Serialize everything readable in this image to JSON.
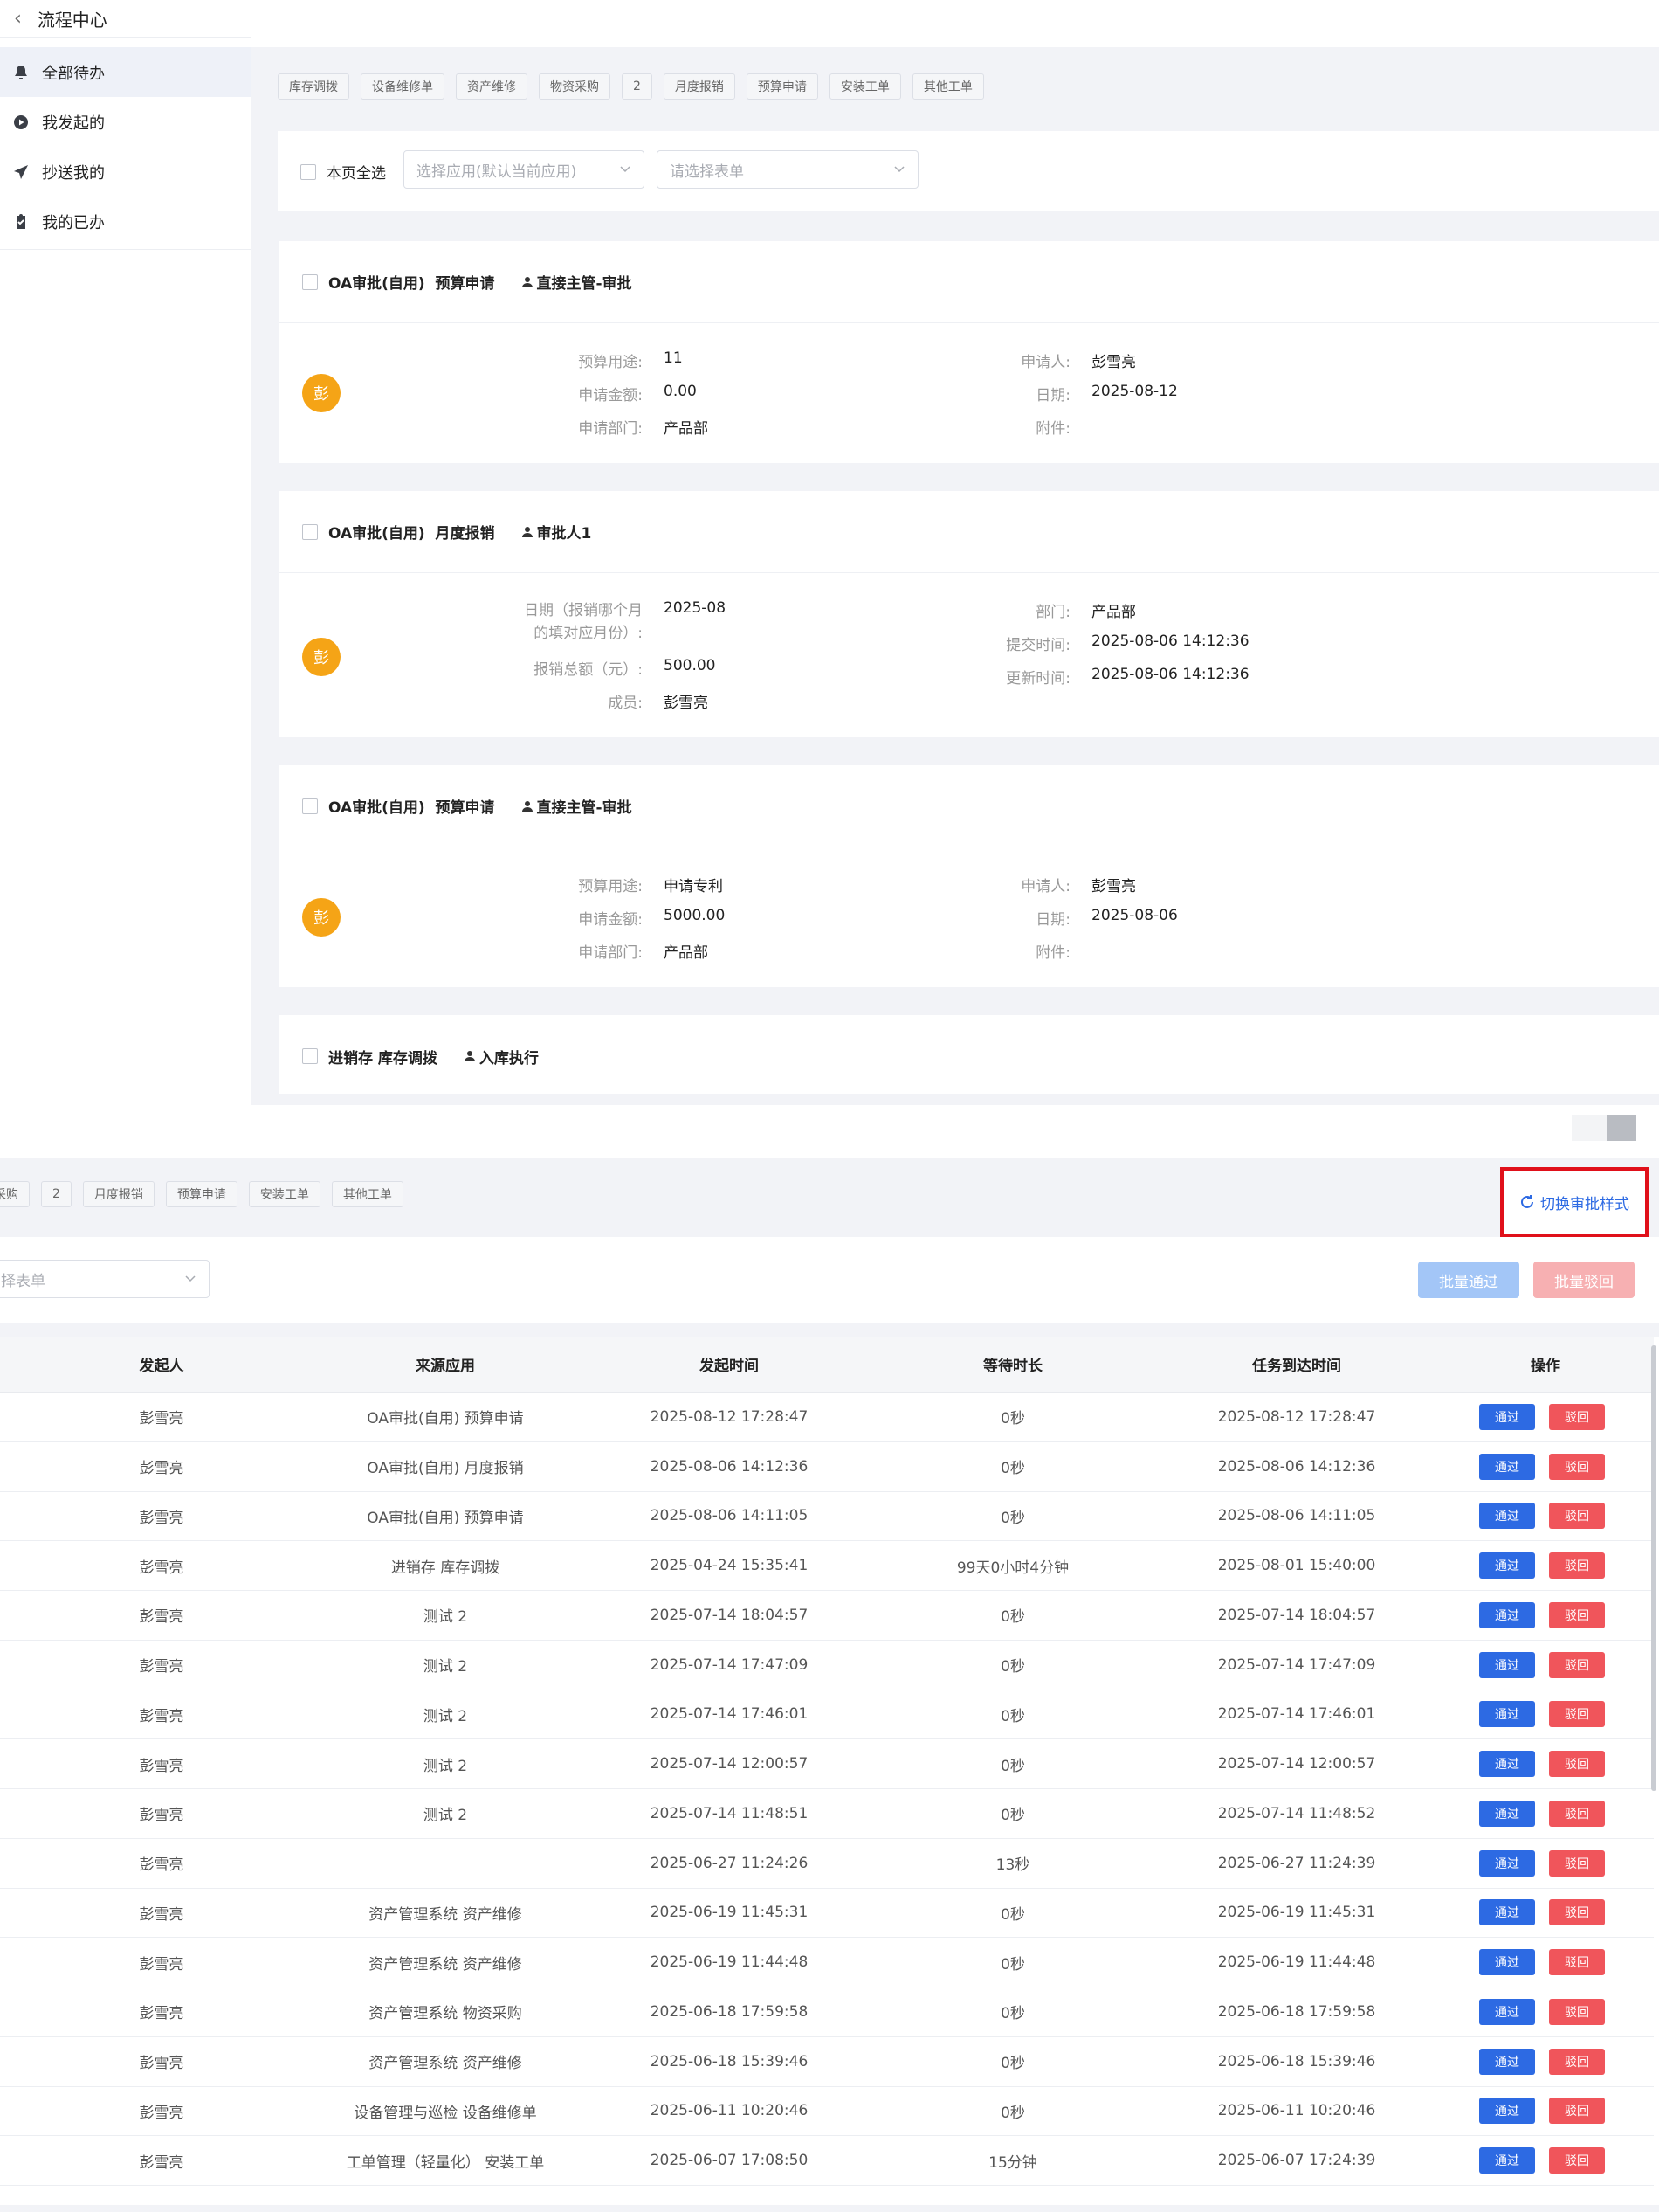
{
  "sidebar": {
    "title": "流程中心",
    "items": [
      {
        "label": "全部待办",
        "icon": "bell-icon",
        "active": true
      },
      {
        "label": "我发起的",
        "icon": "play-circle-icon",
        "active": false
      },
      {
        "label": "抄送我的",
        "icon": "send-icon",
        "active": false
      },
      {
        "label": "我的已办",
        "icon": "clipboard-check-icon",
        "active": false
      }
    ]
  },
  "top": {
    "chips": [
      "库存调拨",
      "设备维修单",
      "资产维修",
      "物资采购",
      "2",
      "月度报销",
      "预算申请",
      "安装工单",
      "其他工单"
    ],
    "select_all_label": "本页全选",
    "app_select_placeholder": "选择应用(默认当前应用)",
    "form_select_placeholder": "请选择表单",
    "cards": [
      {
        "app": "OA审批(自用)",
        "form": "预算申请",
        "node": "直接主管-审批",
        "avatar": "彭",
        "left_fields": [
          {
            "label": "预算用途:",
            "value": "11"
          },
          {
            "label": "申请金额:",
            "value": "0.00"
          },
          {
            "label": "申请部门:",
            "value": "产品部"
          }
        ],
        "right_fields": [
          {
            "label": "申请人:",
            "value": "彭雪亮"
          },
          {
            "label": "日期:",
            "value": "2025-08-12"
          },
          {
            "label": "附件:",
            "value": ""
          }
        ]
      },
      {
        "app": "OA审批(自用)",
        "form": "月度报销",
        "node": "审批人1",
        "avatar": "彭",
        "left_fields": [
          {
            "label": "日期（报销哪个月",
            "label2": "的填对应月份）:",
            "value": "2025-08"
          },
          {
            "label": "报销总额（元）:",
            "value": "500.00"
          },
          {
            "label": "成员:",
            "value": "彭雪亮"
          }
        ],
        "right_fields": [
          {
            "label": "部门:",
            "value": "产品部"
          },
          {
            "label": "提交时间:",
            "value": "2025-08-06 14:12:36"
          },
          {
            "label": "更新时间:",
            "value": "2025-08-06 14:12:36"
          }
        ]
      },
      {
        "app": "OA审批(自用)",
        "form": "预算申请",
        "node": "直接主管-审批",
        "avatar": "彭",
        "left_fields": [
          {
            "label": "预算用途:",
            "value": "申请专利"
          },
          {
            "label": "申请金额:",
            "value": "5000.00"
          },
          {
            "label": "申请部门:",
            "value": "产品部"
          }
        ],
        "right_fields": [
          {
            "label": "申请人:",
            "value": "彭雪亮"
          },
          {
            "label": "日期:",
            "value": "2025-08-06"
          },
          {
            "label": "附件:",
            "value": ""
          }
        ]
      },
      {
        "app": "进销存",
        "form": "库存调拨",
        "node": "入库执行"
      }
    ]
  },
  "bottom": {
    "chips": [
      "采购",
      "2",
      "月度报销",
      "预算申请",
      "安装工单",
      "其他工单"
    ],
    "switch_style_label": "切换审批样式",
    "form_select_placeholder": "择表单",
    "bulk_pass_label": "批量通过",
    "bulk_reject_label": "批量驳回",
    "columns": [
      "发起人",
      "来源应用",
      "发起时间",
      "等待时长",
      "任务到达时间",
      "操作"
    ],
    "pass_label": "通过",
    "reject_label": "驳回",
    "rows": [
      {
        "initiator": "彭雪亮",
        "app": "OA审批(自用)  预算申请",
        "start": "2025-08-12 17:28:47",
        "wait": "0秒",
        "arrive": "2025-08-12 17:28:47"
      },
      {
        "initiator": "彭雪亮",
        "app": "OA审批(自用)  月度报销",
        "start": "2025-08-06 14:12:36",
        "wait": "0秒",
        "arrive": "2025-08-06 14:12:36"
      },
      {
        "initiator": "彭雪亮",
        "app": "OA审批(自用)  预算申请",
        "start": "2025-08-06 14:11:05",
        "wait": "0秒",
        "arrive": "2025-08-06 14:11:05"
      },
      {
        "initiator": "彭雪亮",
        "app": "进销存 库存调拨",
        "start": "2025-04-24 15:35:41",
        "wait": "99天0小时4分钟",
        "arrive": "2025-08-01 15:40:00"
      },
      {
        "initiator": "彭雪亮",
        "app": "测试 2",
        "start": "2025-07-14 18:04:57",
        "wait": "0秒",
        "arrive": "2025-07-14 18:04:57"
      },
      {
        "initiator": "彭雪亮",
        "app": "测试 2",
        "start": "2025-07-14 17:47:09",
        "wait": "0秒",
        "arrive": "2025-07-14 17:47:09"
      },
      {
        "initiator": "彭雪亮",
        "app": "测试 2",
        "start": "2025-07-14 17:46:01",
        "wait": "0秒",
        "arrive": "2025-07-14 17:46:01"
      },
      {
        "initiator": "彭雪亮",
        "app": "测试 2",
        "start": "2025-07-14 12:00:57",
        "wait": "0秒",
        "arrive": "2025-07-14 12:00:57"
      },
      {
        "initiator": "彭雪亮",
        "app": "测试 2",
        "start": "2025-07-14 11:48:51",
        "wait": "0秒",
        "arrive": "2025-07-14 11:48:52"
      },
      {
        "initiator": "彭雪亮",
        "app": "",
        "start": "2025-06-27 11:24:26",
        "wait": "13秒",
        "arrive": "2025-06-27 11:24:39"
      },
      {
        "initiator": "彭雪亮",
        "app": "资产管理系统 资产维修",
        "start": "2025-06-19 11:45:31",
        "wait": "0秒",
        "arrive": "2025-06-19 11:45:31"
      },
      {
        "initiator": "彭雪亮",
        "app": "资产管理系统 资产维修",
        "start": "2025-06-19 11:44:48",
        "wait": "0秒",
        "arrive": "2025-06-19 11:44:48"
      },
      {
        "initiator": "彭雪亮",
        "app": "资产管理系统 物资采购",
        "start": "2025-06-18 17:59:58",
        "wait": "0秒",
        "arrive": "2025-06-18 17:59:58"
      },
      {
        "initiator": "彭雪亮",
        "app": "资产管理系统 资产维修",
        "start": "2025-06-18 15:39:46",
        "wait": "0秒",
        "arrive": "2025-06-18 15:39:46"
      },
      {
        "initiator": "彭雪亮",
        "app": "设备管理与巡检 设备维修单",
        "start": "2025-06-11 10:20:46",
        "wait": "0秒",
        "arrive": "2025-06-11 10:20:46"
      },
      {
        "initiator": "彭雪亮",
        "app": "工单管理（轻量化） 安装工单",
        "start": "2025-06-07 17:08:50",
        "wait": "15分钟",
        "arrive": "2025-06-07 17:24:39"
      }
    ]
  },
  "colors": {
    "primary": "#2d6ae3",
    "danger": "#f0555b",
    "avatar": "#f5a416",
    "highlight_box": "#e0101a"
  }
}
